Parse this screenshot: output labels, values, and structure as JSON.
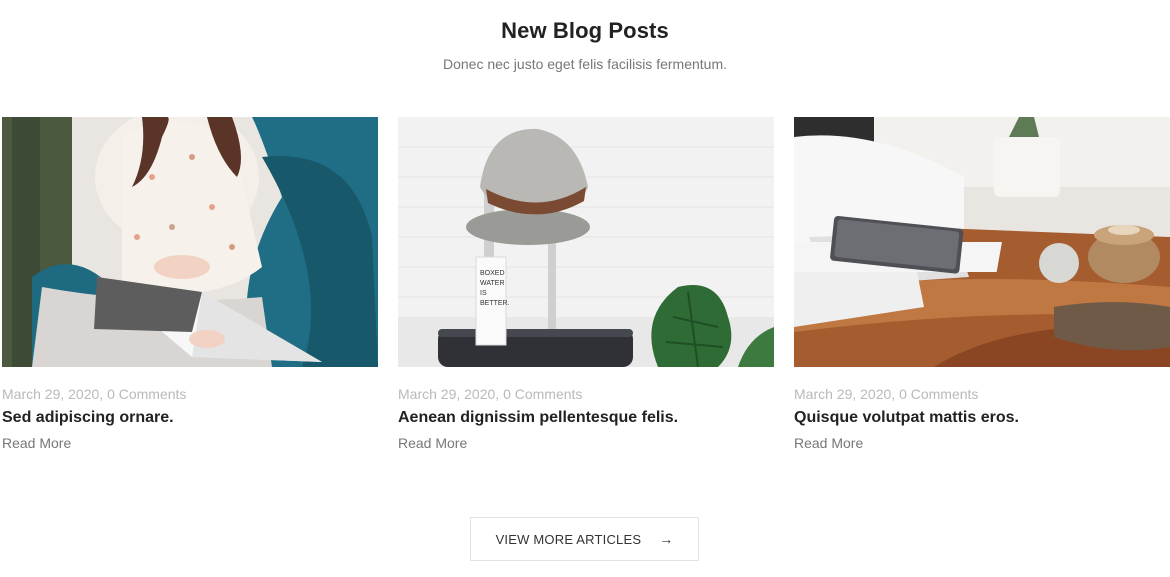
{
  "section": {
    "title": "New Blog Posts",
    "subtitle": "Donec nec justo eget felis facilisis fermentum."
  },
  "posts": [
    {
      "image": "woman-reading-magazine-image",
      "date": "March 29, 2020,",
      "comments": "0 Comments",
      "title": "Sed adipiscing ornare.",
      "read_more": "Read More"
    },
    {
      "image": "hat-on-suitcase-image",
      "date": "March 29, 2020,",
      "comments": "0 Comments",
      "title": "Aenean dignissim pellentesque felis.",
      "read_more": "Read More"
    },
    {
      "image": "laptop-on-wood-table-image",
      "date": "March 29, 2020,",
      "comments": "0 Comments",
      "title": "Quisque volutpat mattis eros.",
      "read_more": "Read More"
    }
  ],
  "view_more": {
    "label": "VIEW MORE ARTICLES",
    "icon": "arrow-right-icon",
    "arrow": "→"
  },
  "colors": {
    "heading": "#222222",
    "muted": "#777777",
    "meta": "#b9b9b9",
    "border": "#e3e3e3"
  }
}
